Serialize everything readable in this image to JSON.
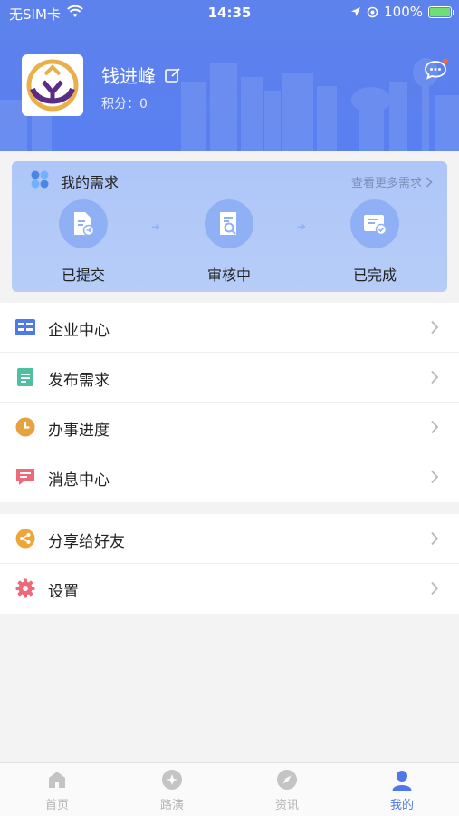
{
  "status_bar": {
    "carrier": "无SIM卡",
    "time": "14:35",
    "battery": "100%"
  },
  "profile": {
    "name": "钱进峰",
    "points_label": "积分：",
    "points_value": "0"
  },
  "demand": {
    "title": "我的需求",
    "more": "查看更多需求",
    "steps": [
      {
        "label": "已提交",
        "icon": "document-submit-icon"
      },
      {
        "label": "审核中",
        "icon": "document-search-icon"
      },
      {
        "label": "已完成",
        "icon": "document-done-icon"
      }
    ]
  },
  "menu_group_1": [
    {
      "label": "企业中心",
      "icon": "enterprise-icon",
      "color": "#4f79e6"
    },
    {
      "label": "发布需求",
      "icon": "publish-icon",
      "color": "#4fbfa2"
    },
    {
      "label": "办事进度",
      "icon": "clock-icon",
      "color": "#e6a23c"
    },
    {
      "label": "消息中心",
      "icon": "message-icon",
      "color": "#ee6a7b"
    }
  ],
  "menu_group_2": [
    {
      "label": "分享给好友",
      "icon": "share-icon",
      "color": "#f0a53a"
    },
    {
      "label": "设置",
      "icon": "gear-icon",
      "color": "#ee6a7b"
    }
  ],
  "tabs": [
    {
      "label": "首页",
      "icon": "home-icon"
    },
    {
      "label": "路演",
      "icon": "roadshow-icon"
    },
    {
      "label": "资讯",
      "icon": "compass-icon"
    },
    {
      "label": "我的",
      "icon": "person-icon",
      "active": true
    }
  ],
  "colors": {
    "header": "#5a7ff0",
    "accent": "#4d78e5",
    "card": "#b2c9f8"
  }
}
